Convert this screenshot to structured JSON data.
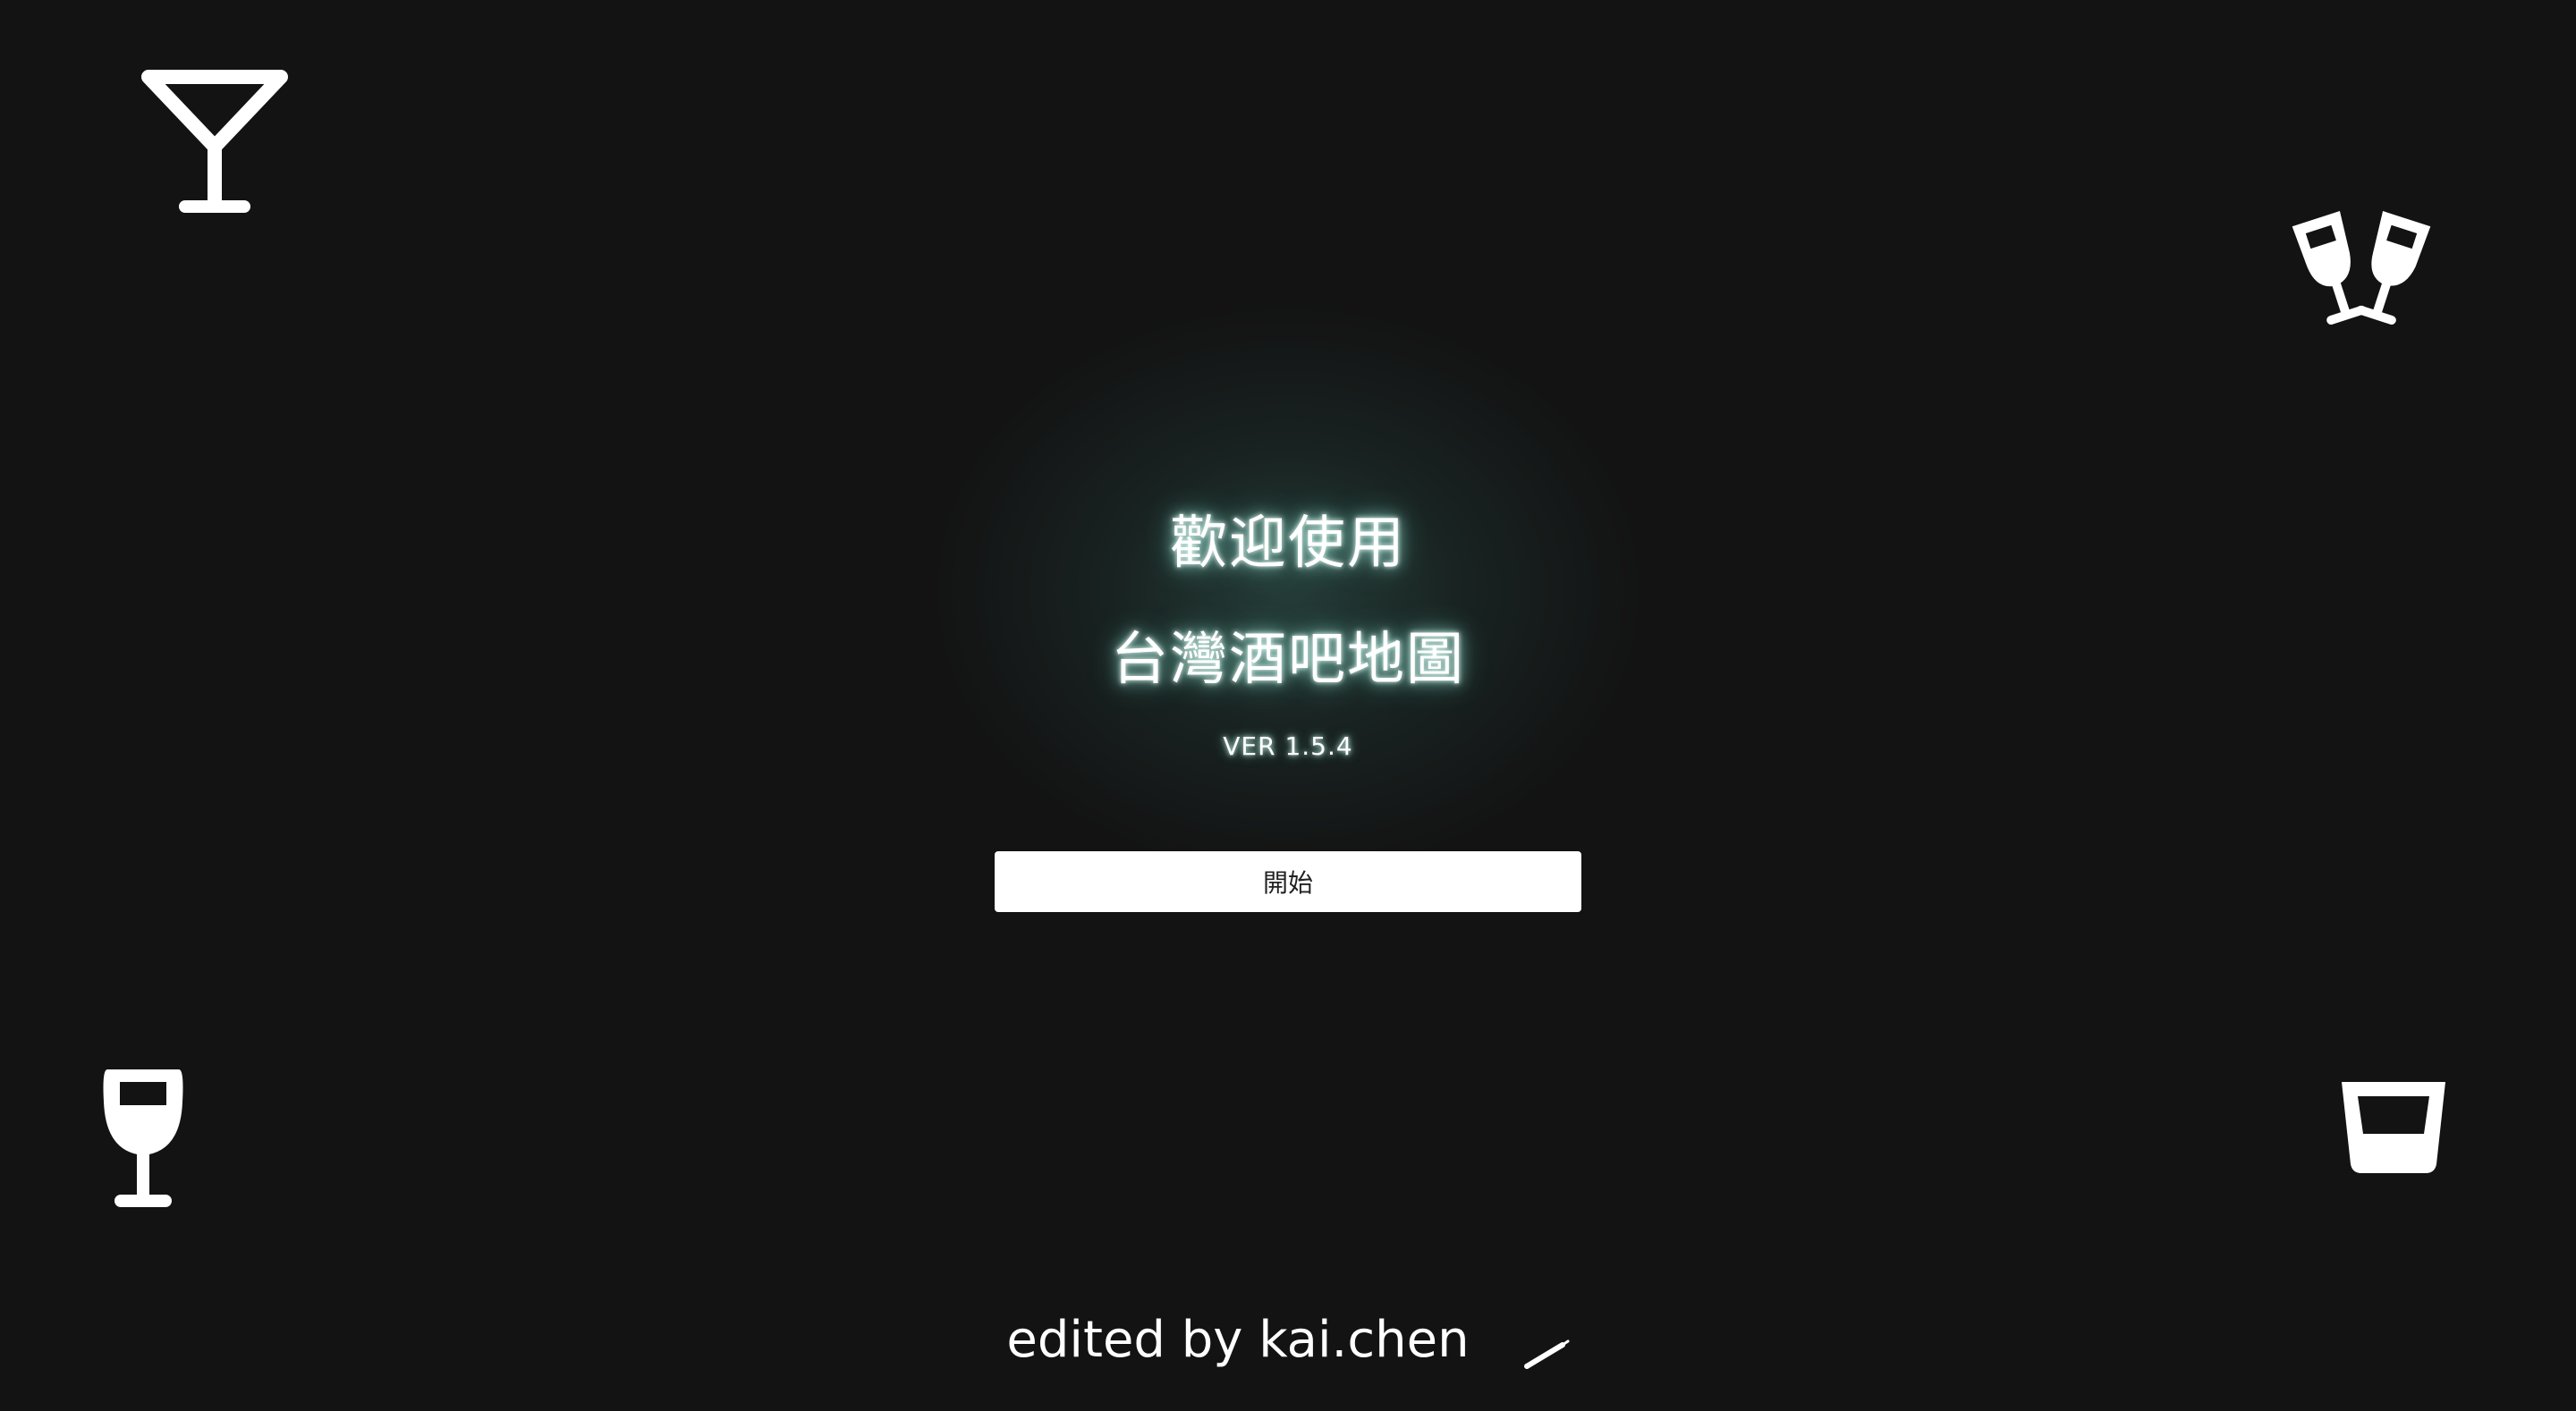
{
  "icons": {
    "top_left": "cocktail-glass-icon",
    "top_right": "cheers-glasses-icon",
    "bottom_left": "wine-glass-icon",
    "bottom_right": "rocks-glass-icon",
    "footer": "pencil-icon"
  },
  "welcome": {
    "line1": "歡迎使用",
    "line2": "台灣酒吧地圖",
    "version": "VER 1.5.4"
  },
  "start_button": {
    "label": "開始"
  },
  "footer": {
    "credit": "edited by kai.chen"
  },
  "colors": {
    "background": "#131313",
    "text": "#ffffff",
    "glow": "#4fa595",
    "button_bg": "#ffffff",
    "button_text": "#222222"
  }
}
